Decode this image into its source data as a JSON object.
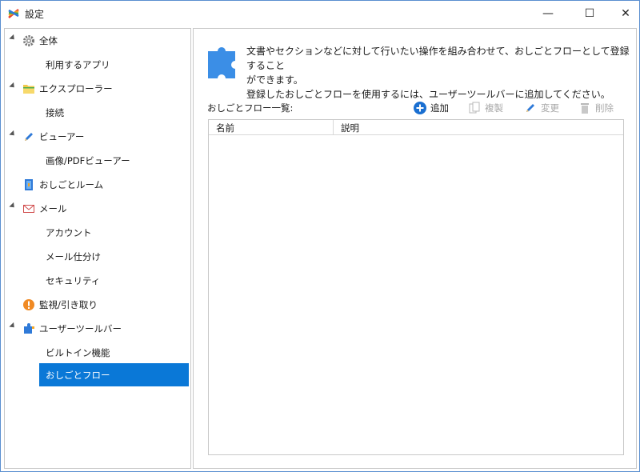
{
  "window": {
    "title": "設定",
    "controls": {
      "minimize": "—",
      "maximize": "☐",
      "close": "✕"
    }
  },
  "sidebar": {
    "items": [
      {
        "label": "全体",
        "icon": "gear-icon",
        "level": 0,
        "expanded": true
      },
      {
        "label": "利用するアプリ",
        "level": 1
      },
      {
        "label": "エクスプローラー",
        "icon": "folder-icon",
        "level": 0,
        "expanded": true
      },
      {
        "label": "接続",
        "level": 1
      },
      {
        "label": "ビューアー",
        "icon": "pen-icon",
        "level": 0,
        "expanded": true
      },
      {
        "label": "画像/PDFビューアー",
        "level": 1
      },
      {
        "label": "おしごとルーム",
        "icon": "room-icon",
        "level": 0
      },
      {
        "label": "メール",
        "icon": "mail-icon",
        "level": 0,
        "expanded": true
      },
      {
        "label": "アカウント",
        "level": 1
      },
      {
        "label": "メール仕分け",
        "level": 1
      },
      {
        "label": "セキュリティ",
        "level": 1
      },
      {
        "label": "監視/引き取り",
        "icon": "alert-icon",
        "level": 0
      },
      {
        "label": "ユーザーツールバー",
        "icon": "toolbar-icon",
        "level": 0,
        "expanded": true
      },
      {
        "label": "ビルトイン機能",
        "level": 1
      },
      {
        "label": "おしごとフロー",
        "level": 1,
        "selected": true
      }
    ]
  },
  "main": {
    "description_line1": "文書やセクションなどに対して行いたい操作を組み合わせて、おしごとフローとして登録すること",
    "description_line2": "ができます。",
    "description_line3": "登録したおしごとフローを使用するには、ユーザーツールバーに追加してください。",
    "list_label": "おしごとフロー一覧:",
    "toolbar": {
      "add": "追加",
      "copy": "複製",
      "edit": "変更",
      "delete": "削除"
    },
    "table": {
      "columns": [
        "名前",
        "説明"
      ],
      "rows": []
    }
  },
  "colors": {
    "accent": "#0a78d7",
    "add_icon": "#1a6fd1"
  }
}
